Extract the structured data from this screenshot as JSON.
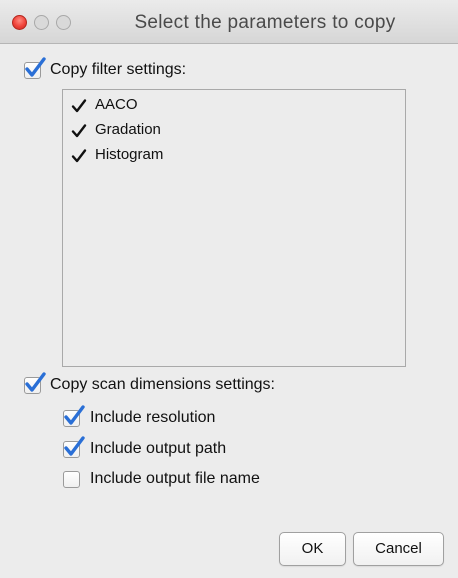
{
  "window": {
    "title": "Select the parameters to copy"
  },
  "filter_section": {
    "label": "Copy filter settings:",
    "checked": true,
    "items": [
      {
        "label": "AACO",
        "checked": true
      },
      {
        "label": "Gradation",
        "checked": true
      },
      {
        "label": "Histogram",
        "checked": true
      }
    ]
  },
  "scan_section": {
    "label": "Copy scan dimensions settings:",
    "checked": true,
    "options": [
      {
        "label": "Include resolution",
        "checked": true
      },
      {
        "label": "Include output path",
        "checked": true
      },
      {
        "label": "Include output file name",
        "checked": false
      }
    ]
  },
  "buttons": {
    "ok_label": "OK",
    "cancel_label": "Cancel"
  },
  "colors": {
    "check_accent": "#2a6fd6"
  }
}
